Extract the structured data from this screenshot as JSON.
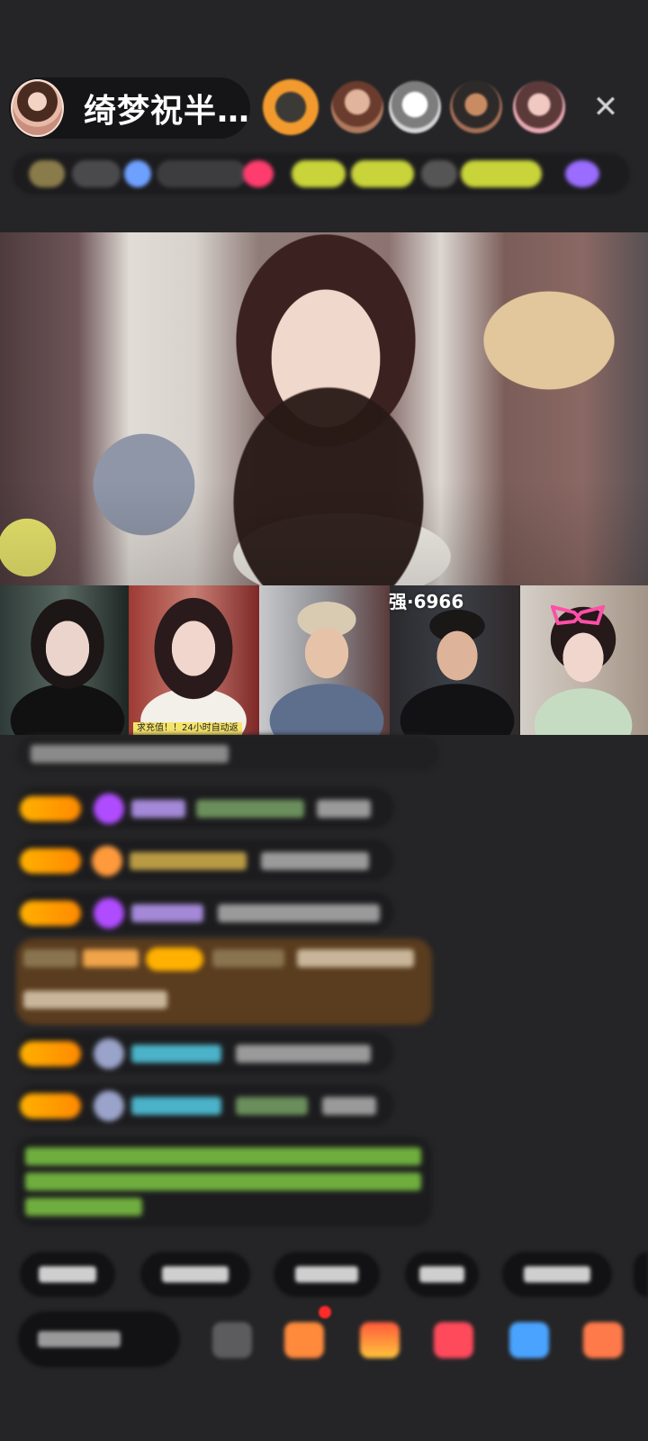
{
  "header": {
    "host_name": "绮梦祝半…",
    "close_icon": "close-icon"
  },
  "viewers": [
    {
      "name": "viewer-avatar-1"
    },
    {
      "name": "viewer-avatar-2"
    },
    {
      "name": "viewer-avatar-3"
    },
    {
      "name": "viewer-avatar-4"
    },
    {
      "name": "viewer-avatar-5"
    }
  ],
  "guest_tiles": {
    "tile2_caption": "求充值！！24小时自动返",
    "tile4_overlay": "强·6966"
  },
  "colors": {
    "background": "#252527",
    "level_badge": "#ffb000",
    "notify_dot": "#ff2a2a"
  },
  "icons": [
    "close-icon",
    "emoji-icon",
    "gift-box-icon",
    "gift-icon",
    "heart-icon",
    "message-icon",
    "game-icon"
  ]
}
